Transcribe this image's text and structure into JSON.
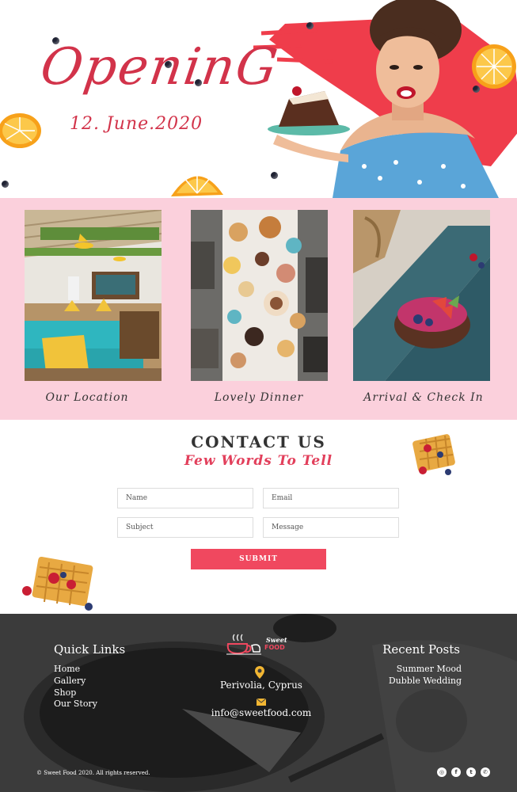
{
  "hero": {
    "title": "OpeninG",
    "date": "12. June.2020"
  },
  "gallery": {
    "cards": [
      {
        "label": "Our Location"
      },
      {
        "label": "Lovely Dinner"
      },
      {
        "label": "Arrival & Check In"
      }
    ]
  },
  "contact": {
    "title": "CONTACT US",
    "subtitle": "Few Words To Tell",
    "name_placeholder": "Name",
    "email_placeholder": "Email",
    "subject_placeholder": "Subject",
    "message_placeholder": "Message",
    "submit_label": "SUBMIT"
  },
  "footer": {
    "quick_links_title": "Quick Links",
    "quick_links": [
      "Home",
      "Gallery",
      "Shop",
      "Our Story"
    ],
    "logo_sweet": "Sweet",
    "logo_food": "FOOD",
    "location": "Perivolia, Cyprus",
    "email": "info@sweetfood.com",
    "recent_posts_title": "Recent Posts",
    "recent_posts": [
      "Summer Mood",
      "Dubble Wedding"
    ],
    "copyright": "© Sweet Food 2020. All rights reserved.",
    "social": [
      "instagram-icon",
      "facebook-icon",
      "twitter-icon",
      "whatsapp-icon"
    ]
  },
  "colors": {
    "accent": "#f0485f",
    "hero_red": "#d2334a",
    "pink_band": "#fbd0dc",
    "footer_bg": "#3a3a3a"
  }
}
